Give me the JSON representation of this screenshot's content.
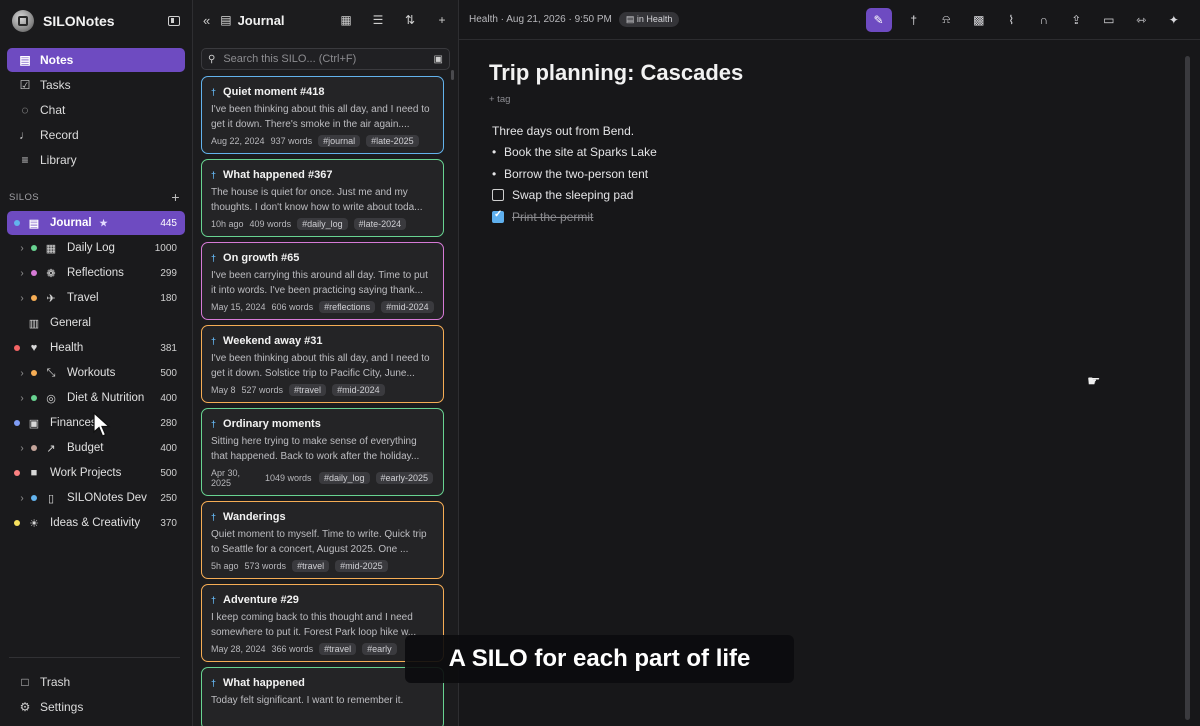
{
  "app": {
    "title": "SILONotes"
  },
  "sidebar": {
    "nav": [
      {
        "label": "Notes",
        "icon": "notes-icon",
        "glyph": "▤",
        "active": true
      },
      {
        "label": "Tasks",
        "icon": "tasks-checkbox-icon",
        "glyph": "☑",
        "active": false
      },
      {
        "label": "Chat",
        "icon": "chat-bubble-icon",
        "glyph": "◌",
        "active": false
      },
      {
        "label": "Record",
        "icon": "microphone-icon",
        "glyph": "♩",
        "active": false
      },
      {
        "label": "Library",
        "icon": "library-icon",
        "glyph": "≡",
        "active": false
      }
    ],
    "silos_heading": "SILOS",
    "silos_add": "+",
    "silos": [
      {
        "label": "Journal",
        "count": "445",
        "dot": "#63b3ed",
        "glyph": "▤",
        "icon": "journal-book-icon",
        "level": 0,
        "active": true,
        "star": true,
        "chevron": false
      },
      {
        "label": "Daily Log",
        "count": "1000",
        "dot": "#68d391",
        "glyph": "▦",
        "icon": "calendar-icon",
        "level": 1,
        "active": false,
        "chevron": true
      },
      {
        "label": "Reflections",
        "count": "299",
        "dot": "#d67ad6",
        "glyph": "❁",
        "icon": "thought-icon",
        "level": 1,
        "active": false,
        "chevron": true
      },
      {
        "label": "Travel",
        "count": "180",
        "dot": "#f6ad55",
        "glyph": "✈",
        "icon": "airplane-icon",
        "level": 1,
        "active": false,
        "chevron": true
      },
      {
        "label": "General",
        "count": "",
        "dot": "",
        "glyph": "▥",
        "icon": "notebook-icon",
        "level": 0,
        "active": false,
        "chevron": false
      },
      {
        "label": "Health",
        "count": "381",
        "dot": "#f56565",
        "glyph": "♥",
        "icon": "heart-pulse-icon",
        "level": 0,
        "active": false,
        "chevron": false
      },
      {
        "label": "Workouts",
        "count": "500",
        "dot": "#f6ad55",
        "glyph": "⤡",
        "icon": "dumbbell-icon",
        "level": 1,
        "active": false,
        "chevron": true
      },
      {
        "label": "Diet & Nutrition",
        "count": "400",
        "dot": "#68d391",
        "glyph": "◎",
        "icon": "apple-icon",
        "level": 1,
        "active": false,
        "chevron": true
      },
      {
        "label": "Finances",
        "count": "280",
        "dot": "#7f9cf5",
        "glyph": "▣",
        "icon": "banknote-icon",
        "level": 0,
        "active": false,
        "chevron": false
      },
      {
        "label": "Budget",
        "count": "400",
        "dot": "#c4a49a",
        "glyph": "↗",
        "icon": "chart-line-icon",
        "level": 1,
        "active": false,
        "chevron": true
      },
      {
        "label": "Work Projects",
        "count": "500",
        "dot": "#fc8181",
        "glyph": "■",
        "icon": "briefcase-icon",
        "level": 0,
        "active": false,
        "chevron": false
      },
      {
        "label": "SILONotes Dev",
        "count": "250",
        "dot": "#63b3ed",
        "glyph": "▯",
        "icon": "smartphone-icon",
        "level": 1,
        "active": false,
        "chevron": true
      },
      {
        "label": "Ideas & Creativity",
        "count": "370",
        "dot": "#f6e05e",
        "glyph": "☀",
        "icon": "lightbulb-icon",
        "level": 0,
        "active": false,
        "chevron": false
      }
    ],
    "bottom": [
      {
        "label": "Trash",
        "icon": "trash-icon",
        "glyph": "□"
      },
      {
        "label": "Settings",
        "icon": "gear-icon",
        "glyph": "⚙"
      }
    ]
  },
  "notes_pane": {
    "back": "«",
    "title": "Journal",
    "search_placeholder": "Search this SILO... (Ctrl+F)",
    "cards": [
      {
        "title": "Quiet moment #418",
        "body": "I've been thinking about this all day, and I need to get it down. There's smoke in the air again....",
        "date": "Aug 22, 2024",
        "words": "937 words",
        "tags": [
          "#journal",
          "#late-2025"
        ],
        "border": "#63b3ed",
        "pinned": true
      },
      {
        "title": "What happened #367",
        "body": "The house is quiet for once. Just me and my thoughts. I don't know how to write about toda...",
        "date": "10h ago",
        "words": "409 words",
        "tags": [
          "#daily_log",
          "#late-2024"
        ],
        "border": "#68d391",
        "pinned": true
      },
      {
        "title": "On growth #65",
        "body": "I've been carrying this around all day. Time to put it into words. I've been practicing saying thank...",
        "date": "May 15, 2024",
        "words": "606 words",
        "tags": [
          "#reflections",
          "#mid-2024"
        ],
        "border": "#d67ad6",
        "pinned": true
      },
      {
        "title": "Weekend away #31",
        "body": "I've been thinking about this all day, and I need to get it down. Solstice trip to Pacific City, June...",
        "date": "May 8",
        "words": "527 words",
        "tags": [
          "#travel",
          "#mid-2024"
        ],
        "border": "#f6ad55",
        "pinned": true
      },
      {
        "title": "Ordinary moments",
        "body": "Sitting here trying to make sense of everything that happened. Back to work after the holiday...",
        "date": "Apr 30, 2025",
        "words": "1049 words",
        "tags": [
          "#daily_log",
          "#early-2025"
        ],
        "border": "#68d391",
        "pinned": true
      },
      {
        "title": "Wanderings",
        "body": "Quiet moment to myself. Time to write. Quick trip to Seattle for a concert, August 2025. One ...",
        "date": "5h ago",
        "words": "573 words",
        "tags": [
          "#travel",
          "#mid-2025"
        ],
        "border": "#f6ad55",
        "pinned": true
      },
      {
        "title": "Adventure #29",
        "body": "I keep coming back to this thought and I need somewhere to put it. Forest Park loop hike w...",
        "date": "May 28, 2024",
        "words": "366 words",
        "tags": [
          "#travel",
          "#early"
        ],
        "border": "#f6ad55",
        "pinned": true
      },
      {
        "title": "What happened",
        "body": "Today felt significant. I want to remember it.",
        "date": "",
        "words": "",
        "tags": [],
        "border": "#68d391",
        "pinned": true
      }
    ]
  },
  "editor": {
    "breadcrumb": "Health · Aug 21, 2026 · 9:50 PM",
    "badge": "in Health",
    "title": "Trip planning: Cascades",
    "add_tag": "+ tag",
    "lines": [
      {
        "type": "text",
        "text": "Three days out from Bend."
      },
      {
        "type": "bullet",
        "text": "Book the site at Sparks Lake"
      },
      {
        "type": "bullet",
        "text": "Borrow the two-person tent"
      },
      {
        "type": "todo",
        "text": "Swap the sleeping pad",
        "checked": false
      },
      {
        "type": "todo",
        "text": "Print the permit",
        "checked": true
      }
    ],
    "tools": [
      {
        "name": "edit-pencil-icon",
        "glyph": "✎",
        "active": true
      },
      {
        "name": "pin-icon",
        "glyph": "†",
        "active": false
      },
      {
        "name": "bell-icon",
        "glyph": "⍾",
        "active": false
      },
      {
        "name": "image-add-icon",
        "glyph": "▩",
        "active": false
      },
      {
        "name": "paperclip-icon",
        "glyph": "⌇",
        "active": false
      },
      {
        "name": "headphones-icon",
        "glyph": "∩",
        "active": false
      },
      {
        "name": "share-icon",
        "glyph": "⇪",
        "active": false
      },
      {
        "name": "move-folder-icon",
        "glyph": "▭",
        "active": false
      },
      {
        "name": "full-width-icon",
        "glyph": "⇿",
        "active": false
      },
      {
        "name": "ai-sparkle-icon",
        "glyph": "✦",
        "active": false
      }
    ]
  },
  "caption": "A SILO for each part of life",
  "colors": {
    "accent": "#6e4bc1",
    "pin": "#63b3ed"
  }
}
